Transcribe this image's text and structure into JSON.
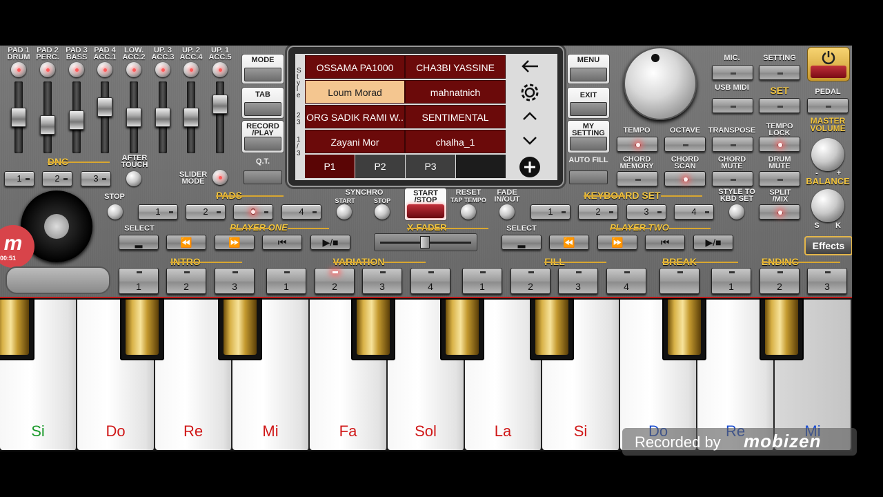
{
  "mixer": {
    "channels": [
      {
        "line1": "PAD 1",
        "line2": "DRUM",
        "level": 0.5
      },
      {
        "line1": "PAD 2",
        "line2": "PERC.",
        "level": 0.35
      },
      {
        "line1": "PAD 3",
        "line2": "BASS",
        "level": 0.45
      },
      {
        "line1": "PAD 4",
        "line2": "ACC.1",
        "level": 0.7
      },
      {
        "line1": "LOW.",
        "line2": "ACC.2",
        "level": 0.5
      },
      {
        "line1": "UP. 3",
        "line2": "ACC.3",
        "level": 0.5
      },
      {
        "line1": "UP. 2",
        "line2": "ACC.4",
        "level": 0.5
      },
      {
        "line1": "UP. 1",
        "line2": "ACC.5",
        "level": 0.75
      }
    ],
    "dnc": "DNC",
    "dnc_buttons": [
      "1",
      "2",
      "3"
    ],
    "after_touch": "AFTER TOUCH",
    "slider_mode": "SLIDER MODE"
  },
  "left_menu": {
    "mode": "MODE",
    "tab": "TAB",
    "record": "RECORD /PLAY",
    "qt": "Q.T."
  },
  "screen": {
    "side_text_1": "S t y l e",
    "side_text_2": "2 3",
    "side_text_3": "1 / 3",
    "styles": [
      "OSSAMA PA1000",
      "CHA3BI YASSINE",
      "Loum Morad",
      "mahnatnich",
      "ORG SADIK RAMI W..",
      "SENTIMENTAL",
      "Zayani Mor",
      "chalha_1"
    ],
    "selected_style": "Loum Morad",
    "pages": [
      "P1",
      "P2",
      "P3"
    ],
    "active_page": "P1"
  },
  "right_menu": {
    "menu": "MENU",
    "exit": "EXIT",
    "my_setting": "MY SETTING",
    "auto_fill": "AUTO FILL"
  },
  "top_right": {
    "mic": "MIC.",
    "setting": "SETTING",
    "usb_midi": "USB MIDI",
    "set": "SET",
    "pedal": "PEDAL",
    "tempo": "TEMPO",
    "octave": "OCTAVE",
    "transpose": "TRANSPOSE",
    "tempo_lock": "TEMPO LOCK",
    "chord_memory": "CHORD MEMORY",
    "chord_scan": "CHORD SCAN",
    "chord_mute": "CHORD MUTE",
    "drum_mute": "DRUM MUTE",
    "master_volume": "MASTER VOLUME",
    "balance": "BALANCE",
    "bal_s": "S",
    "bal_k": "K",
    "minus": "-",
    "plus": "+"
  },
  "pads": {
    "stop": "STOP",
    "label": "PADS",
    "buttons": [
      "1",
      "2",
      "3",
      "4"
    ]
  },
  "transport": {
    "synchro": "SYNCHRO",
    "sync_start": "START",
    "sync_stop": "STOP",
    "start_stop": "START /STOP",
    "reset": "RESET",
    "tap_tempo": "TAP TEMPO",
    "fade": "FADE IN/OUT",
    "xfader": "X-FADER"
  },
  "keyboard_set": {
    "label": "KEYBOARD SET",
    "buttons": [
      "1",
      "2",
      "3",
      "4"
    ],
    "style_to_kbd": "STYLE TO KBD SET",
    "split_mix": "SPLIT /MIX"
  },
  "players": {
    "select": "SELECT",
    "player_one": "PLAYER ONE",
    "player_two": "PLAYER TWO",
    "effects": "Effects"
  },
  "style_sections": {
    "intro": "INTRO",
    "variation": "VARIATION",
    "fill": "FILL",
    "break": "BREAK",
    "ending": "ENDING",
    "intro_btns": [
      "1",
      "2",
      "3"
    ],
    "var_btns": [
      "1",
      "2",
      "3",
      "4"
    ],
    "fill_btns": [
      "1",
      "2",
      "3",
      "4"
    ],
    "end_btns": [
      "1",
      "2",
      "3"
    ]
  },
  "keys": {
    "white": [
      "Si",
      "Do",
      "Re",
      "Mi",
      "Fa",
      "Sol",
      "La",
      "Si",
      "Do",
      "Re",
      "Mi"
    ]
  },
  "overlay": {
    "recorded_by": "Recorded by",
    "brand": "mobizen",
    "timer": "00:51"
  }
}
